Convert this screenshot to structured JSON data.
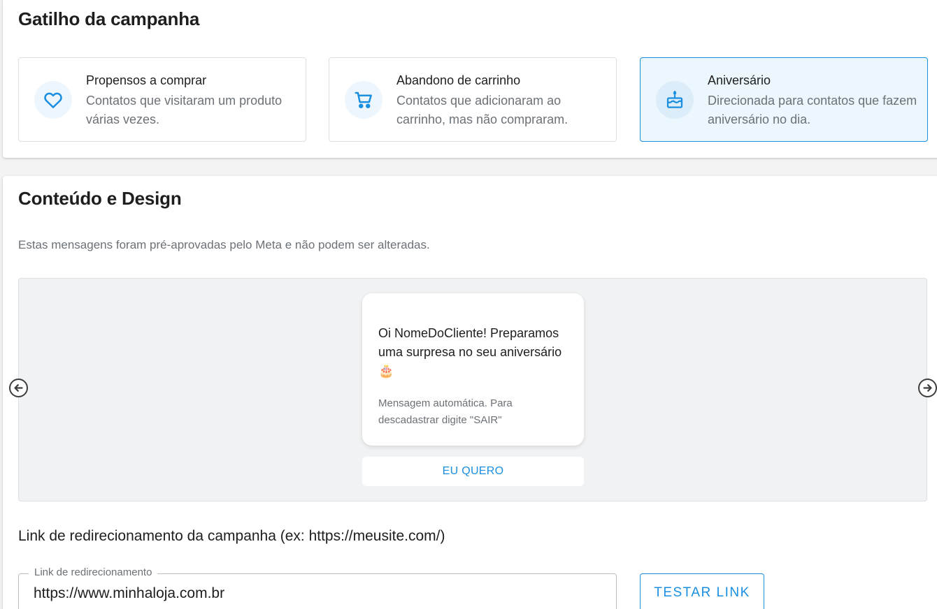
{
  "trigger": {
    "title": "Gatilho da campanha",
    "options": [
      {
        "title": "Propensos a comprar",
        "description": "Contatos que visitaram um produto várias vezes.",
        "icon": "heart-icon",
        "selected": false
      },
      {
        "title": "Abandono de carrinho",
        "description": "Contatos que adicionaram ao carrinho, mas não compraram.",
        "icon": "cart-icon",
        "selected": false
      },
      {
        "title": "Aniversário",
        "description": "Direcionada para contatos que fazem aniversário no dia.",
        "icon": "cake-icon",
        "selected": true
      }
    ]
  },
  "content": {
    "title": "Conteúdo e Design",
    "subtitle": "Estas mensagens foram pré-aprovadas pelo Meta e não podem ser alteradas.",
    "preview": {
      "message": "Oi NomeDoCliente! Preparamos uma surpresa no seu aniversário 🎂",
      "footer": "Mensagem automática. Para descadastrar digite \"SAIR\"",
      "cta_label": "EU QUERO"
    },
    "link": {
      "label": "Link de redirecionamento da campanha (ex: https://meusite.com/)",
      "field_label": "Link de redirecionamento",
      "value": "https://www.minhaloja.com.br",
      "test_button": "TESTAR LINK"
    }
  },
  "colors": {
    "accent": "#1a8fe0",
    "selected_bg": "#ebf7fd",
    "muted_text": "#6b7177"
  }
}
